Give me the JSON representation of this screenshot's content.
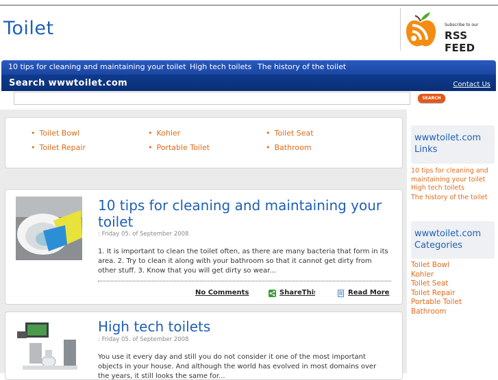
{
  "header": {
    "site_title": "Toilet"
  },
  "rss": {
    "subscribe_text": "Subscribe to our",
    "feed_text": "RSS FEED"
  },
  "nav": {
    "items": [
      "10 tips for cleaning and maintaining your toilet",
      "High tech toilets",
      "The history of the toilet"
    ]
  },
  "search": {
    "title": "Search wwwtoilet.com",
    "contact_label": "Contact Us",
    "input_value": "",
    "button_label": "SEARCH"
  },
  "categories_box": {
    "items": [
      "Toilet Bowl",
      "Kohler",
      "Toilet Seat",
      "Toilet Repair",
      "Portable Toilet",
      "Bathroom"
    ]
  },
  "posts": [
    {
      "title_line1": "10 tips for cleaning and maintaining your",
      "title_line2": "toilet",
      "date": ": Friday 05. of September 2008",
      "excerpt": "1. It is important to clean the toilet often, as there are many bacteria that form in its area. 2. Try to clean it along with your bathroom so that it cannot get dirty from other stuff. 3. Know that you will get dirty so wear...",
      "comments_label": "No Comments",
      "share_label": "ShareThis",
      "read_more_label": "Read More"
    },
    {
      "title_line1": "High tech toilets",
      "date": ": Friday 05. of September 2008",
      "excerpt": "You use it every day and still you do not consider it one of the most important objects in your house. And although the world has evolved in most domains over the years, it still looks the same for..."
    }
  ],
  "sidebar": {
    "links_heading": "wwwtoilet.com Links",
    "links": [
      "10 tips for cleaning and maintaining your toilet",
      "High tech toilets",
      "The history of the toilet"
    ],
    "categories_heading": "wwwtoilet.com Categories",
    "categories": [
      "Toilet Bowl",
      "Kohler",
      "Toilet Seat",
      "Toilet Repair",
      "Portable Toilet",
      "Bathroom"
    ]
  },
  "colors": {
    "brand_blue": "#1f5fb5",
    "nav_blue": "#1b46a2",
    "accent_orange": "#e06a1a",
    "button_orange": "#e5571a"
  }
}
